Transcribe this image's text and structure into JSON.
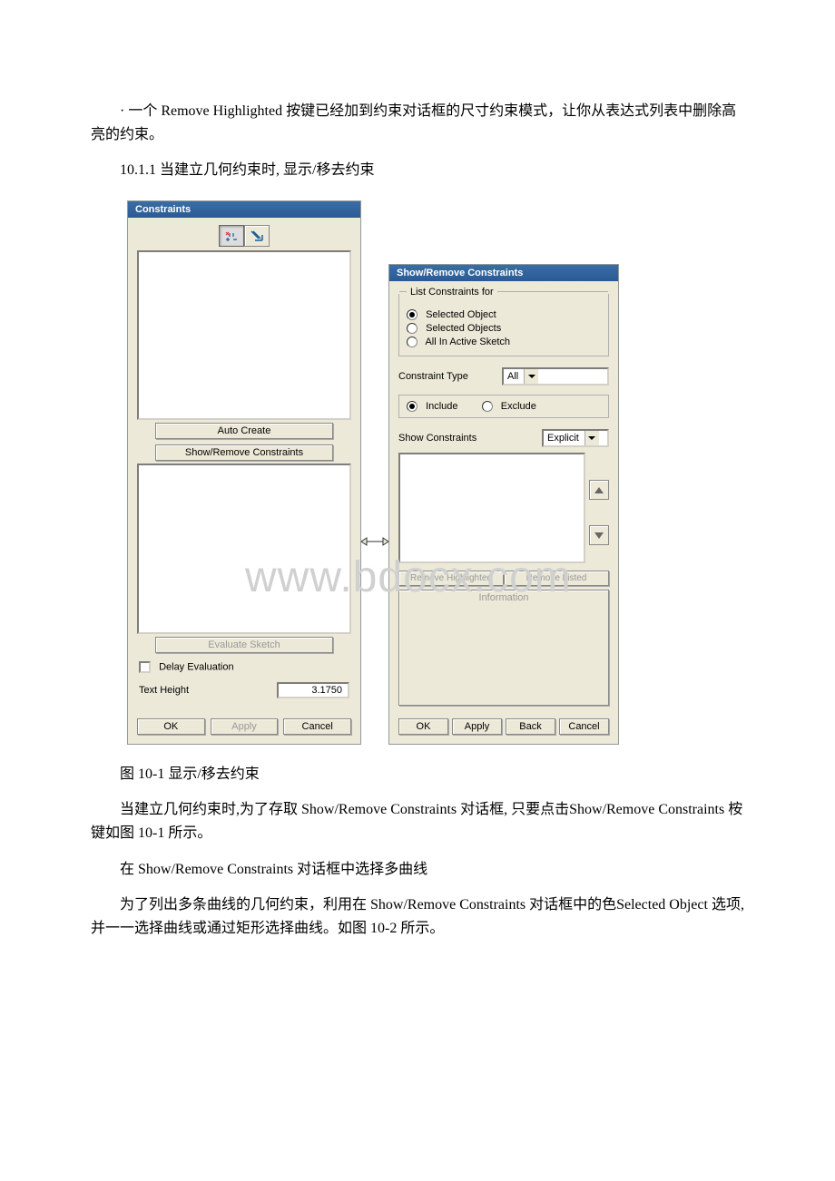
{
  "paragraphs": {
    "p1": "· 一个 Remove Highlighted 按键已经加到约束对话框的尺寸约束模式，让你从表达式列表中删除高亮的约束。",
    "p2": "10.1.1 当建立几何约束时, 显示/移去约束",
    "caption": "图 10-1 显示/移去约束",
    "p3": "当建立几何约束时,为了存取 Show/Remove Constraints 对话框, 只要点击Show/Remove Constraints 桉键如图 10-1 所示。",
    "p4": "在 Show/Remove Constraints 对话框中选择多曲线",
    "p5": "为了列出多条曲线的几何约束，利用在 Show/Remove Constraints 对话框中的色Selected Object 选项, 并一一选择曲线或通过矩形选择曲线。如图 10-2 所示。"
  },
  "watermark": "www.bdocx.com",
  "left_dialog": {
    "title": "Constraints",
    "auto_create": "Auto Create",
    "show_remove": "Show/Remove Constraints",
    "evaluate_sketch": "Evaluate Sketch",
    "delay_eval": "Delay Evaluation",
    "text_height_label": "Text Height",
    "text_height_value": "3.1750",
    "ok": "OK",
    "apply": "Apply",
    "cancel": "Cancel"
  },
  "right_dialog": {
    "title": "Show/Remove Constraints",
    "group_label": "List Constraints for",
    "opt_selected_object": "Selected Object",
    "opt_selected_objects": "Selected Objects",
    "opt_all_active": "All In Active Sketch",
    "constraint_type_label": "Constraint Type",
    "constraint_type_value": "All",
    "include": "Include",
    "exclude": "Exclude",
    "show_constraints_label": "Show Constraints",
    "show_constraints_value": "Explicit",
    "remove_highlighted": "Remove Highlighted",
    "remove_listed": "Remove Listed",
    "information": "Information",
    "ok": "OK",
    "apply": "Apply",
    "back": "Back",
    "cancel": "Cancel"
  }
}
